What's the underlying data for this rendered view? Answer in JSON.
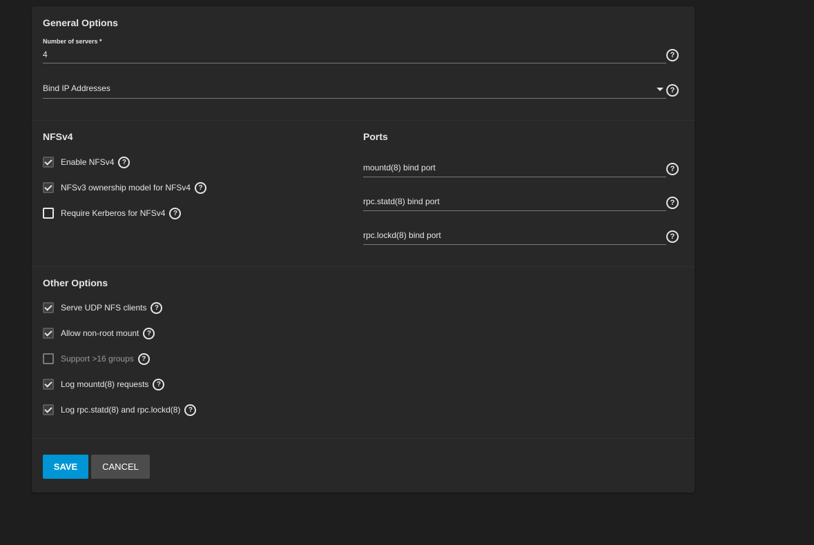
{
  "general": {
    "title": "General Options",
    "servers_label": "Number of servers *",
    "servers_value": "4",
    "bind_ip_placeholder": "Bind IP Addresses"
  },
  "nfsv4": {
    "title": "NFSv4",
    "items": [
      {
        "label": "Enable NFSv4",
        "checked": true
      },
      {
        "label": "NFSv3 ownership model for NFSv4",
        "checked": true
      },
      {
        "label": "Require Kerberos for NFSv4",
        "checked": false
      }
    ]
  },
  "ports": {
    "title": "Ports",
    "mountd": "mountd(8) bind port",
    "statd": "rpc.statd(8) bind port",
    "lockd": "rpc.lockd(8) bind port"
  },
  "other": {
    "title": "Other Options",
    "items": [
      {
        "label": "Serve UDP NFS clients",
        "checked": true
      },
      {
        "label": "Allow non-root mount",
        "checked": true
      },
      {
        "label": "Support >16 groups",
        "checked": false,
        "disabled": true
      },
      {
        "label": "Log mountd(8) requests",
        "checked": true
      },
      {
        "label": "Log rpc.statd(8) and rpc.lockd(8)",
        "checked": true
      }
    ]
  },
  "actions": {
    "save": "SAVE",
    "cancel": "CANCEL"
  },
  "help_glyph": "?",
  "colors": {
    "background": "#1e1e1e",
    "card": "#282828",
    "primary": "#0095d5",
    "cancel": "#4c4c4c"
  }
}
